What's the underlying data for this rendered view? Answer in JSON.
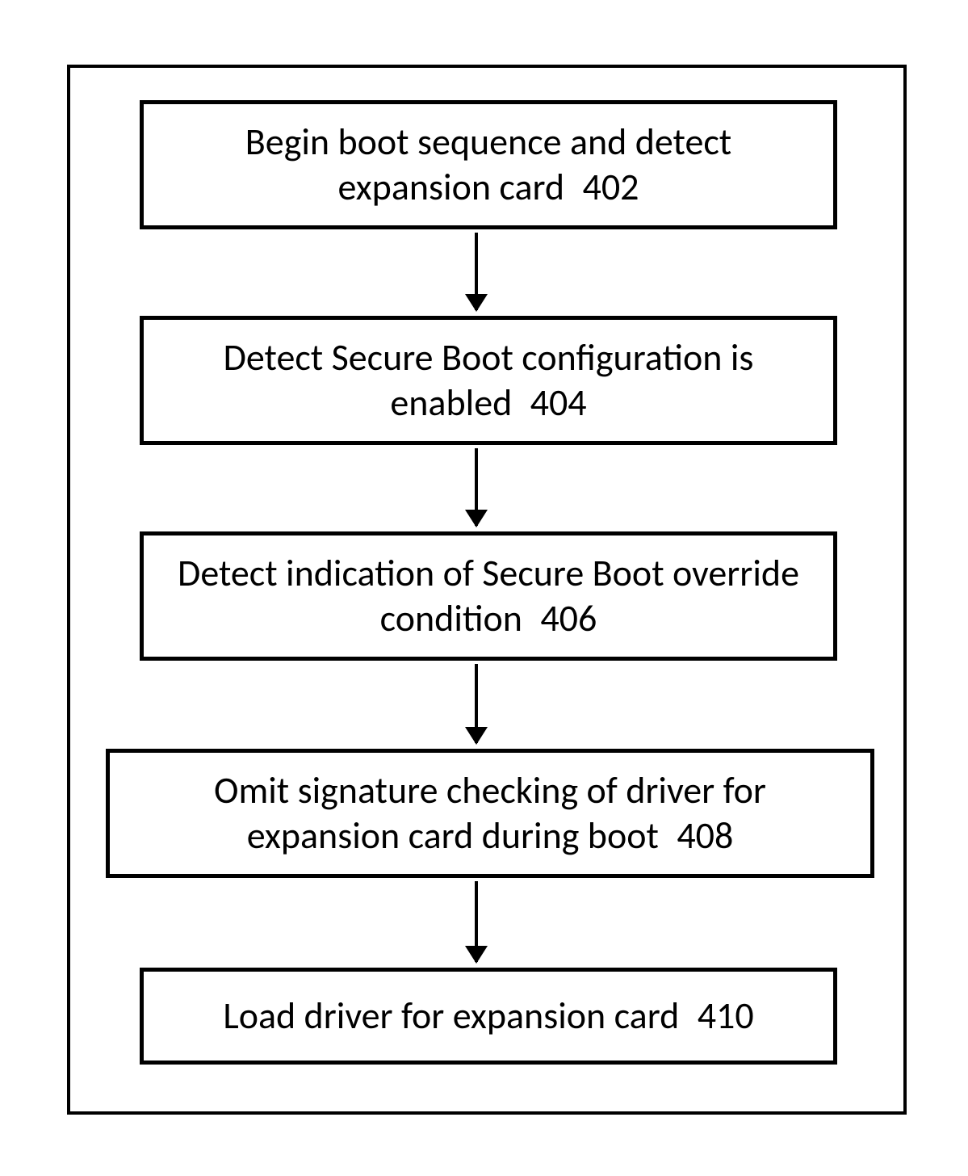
{
  "flowchart": {
    "steps": [
      {
        "text": "Begin boot sequence  and detect expansion card",
        "ref": "402"
      },
      {
        "text": "Detect Secure Boot configuration is enabled",
        "ref": "404"
      },
      {
        "text": "Detect indication of Secure Boot override condition",
        "ref": "406"
      },
      {
        "text": "Omit signature checking of driver for expansion card  during boot",
        "ref": "408"
      },
      {
        "text": "Load driver for expansion card",
        "ref": "410"
      }
    ]
  }
}
